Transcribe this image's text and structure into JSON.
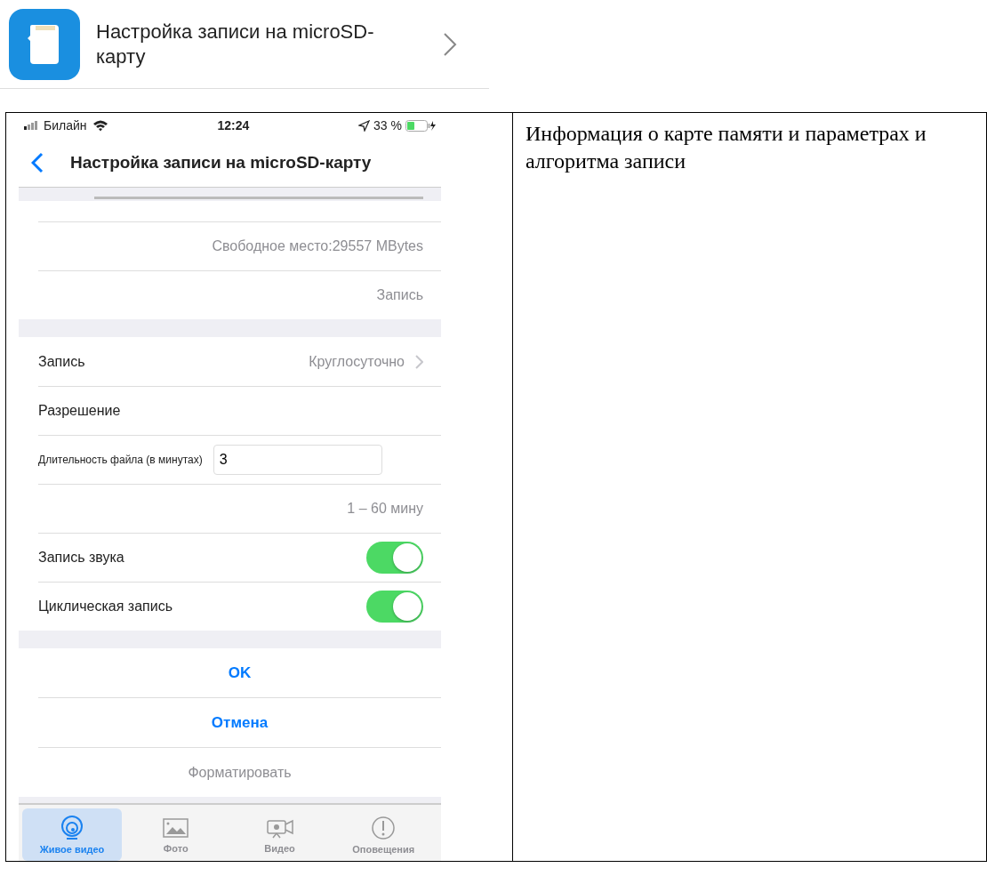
{
  "menu_item": {
    "label": "Настройка записи на microSD-карту"
  },
  "phone": {
    "status_bar": {
      "carrier": "Билайн",
      "time": "12:24",
      "battery": "33 %"
    },
    "nav": {
      "title": "Настройка записи на microSD-карту"
    },
    "info_rows": [
      "Свободное место:29557 MBytes",
      "Запись"
    ],
    "settings": [
      {
        "kind": "link",
        "label": "Запись",
        "value": "Круглосуточно"
      },
      {
        "kind": "label",
        "label": "Разрешение"
      },
      {
        "kind": "field",
        "label": "Длительность файла (в минутах)",
        "value": "3"
      },
      {
        "kind": "hint",
        "value": "1 – 60 мину"
      },
      {
        "kind": "toggle",
        "label": "Запись звука",
        "on": true
      },
      {
        "kind": "toggle",
        "label": "Циклическая запись",
        "on": true
      }
    ],
    "actions": [
      {
        "label": "OK",
        "primary": true
      },
      {
        "label": "Отмена",
        "primary": true
      },
      {
        "label": "Форматировать",
        "primary": false
      }
    ],
    "tabs": [
      {
        "label": "Живое видео",
        "kind": "camera",
        "selected": true
      },
      {
        "label": "Фото",
        "kind": "photo",
        "selected": false
      },
      {
        "label": "Видео",
        "kind": "video",
        "selected": false
      },
      {
        "label": "Оповещения",
        "kind": "alert",
        "selected": false
      }
    ]
  },
  "description": "Информация о карте памяти и параметрах и алгоритма записи"
}
